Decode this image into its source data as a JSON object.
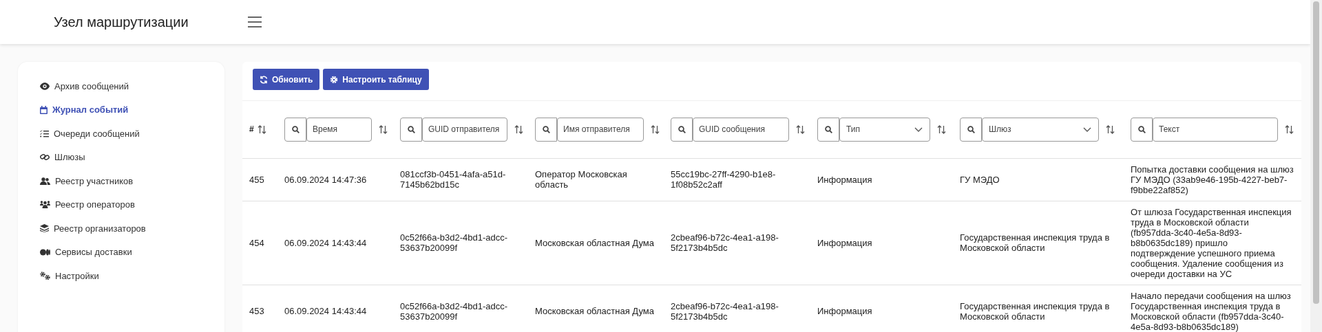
{
  "app_title": "Узел маршрутизации",
  "sidebar": {
    "items": [
      {
        "label": "Архив сообщений",
        "selected": false
      },
      {
        "label": "Журнал событий",
        "selected": true
      },
      {
        "label": "Очереди сообщений",
        "selected": false
      },
      {
        "label": "Шлюзы",
        "selected": false
      },
      {
        "label": "Реестр участников",
        "selected": false
      },
      {
        "label": "Реестр операторов",
        "selected": false
      },
      {
        "label": "Реестр организаторов",
        "selected": false
      },
      {
        "label": "Сервисы доставки",
        "selected": false
      },
      {
        "label": "Настройки",
        "selected": false
      }
    ]
  },
  "toolbar": {
    "buttons": [
      {
        "kind": "refresh",
        "label": "Обновить"
      },
      {
        "kind": "settings",
        "label": "Настроить таблицу"
      }
    ]
  },
  "table": {
    "columns": [
      {
        "kind": "plain",
        "label": "#"
      },
      {
        "kind": "text",
        "placeholder": "Время"
      },
      {
        "kind": "text",
        "placeholder": "GUID отправителя"
      },
      {
        "kind": "text",
        "placeholder": "Имя отправителя"
      },
      {
        "kind": "text",
        "placeholder": "GUID сообщения"
      },
      {
        "kind": "select",
        "placeholder": "Тип"
      },
      {
        "kind": "select",
        "placeholder": "Шлюз"
      },
      {
        "kind": "text",
        "placeholder": "Текст"
      }
    ],
    "rows": [
      [
        "455",
        "06.09.2024 14:47:36",
        "081ccf3b-0451-4afa-a51d-7145b62bd15c",
        "Оператор Московская область",
        "55cc19bc-27ff-4290-b1e8-1f08b52c2aff",
        "Информация",
        "ГУ МЭДО",
        "Попытка доставки сообщения на шлюз ГУ МЭДО (33ab9e46-195b-4227-beb7-f9bbe22af852)"
      ],
      [
        "454",
        "06.09.2024 14:43:44",
        "0c52f66a-b3d2-4bd1-adcc-53637b20099f",
        "Московская областная Дума",
        "2cbeaf96-b72c-4ea1-a198-5f2173b4b5dc",
        "Информация",
        "Государственная инспекция труда в Московской области",
        "От шлюза Государственная инспекция труда в Московской области (fb957dda-3c40-4e5a-8d93-b8b0635dc189) пришло подтверждение успешного приема сообщения. Удаление сообщения из очереди доставки на УС"
      ],
      [
        "453",
        "06.09.2024 14:43:44",
        "0c52f66a-b3d2-4bd1-adcc-53637b20099f",
        "Московская областная Дума",
        "2cbeaf96-b72c-4ea1-a198-5f2173b4b5dc",
        "Информация",
        "Государственная инспекция труда в Московской области",
        "Начало передачи сообщения на шлюз Государственная инспекция труда в Московской области (fb957dda-3c40-4e5a-8d93-b8b0635dc189)"
      ]
    ]
  }
}
